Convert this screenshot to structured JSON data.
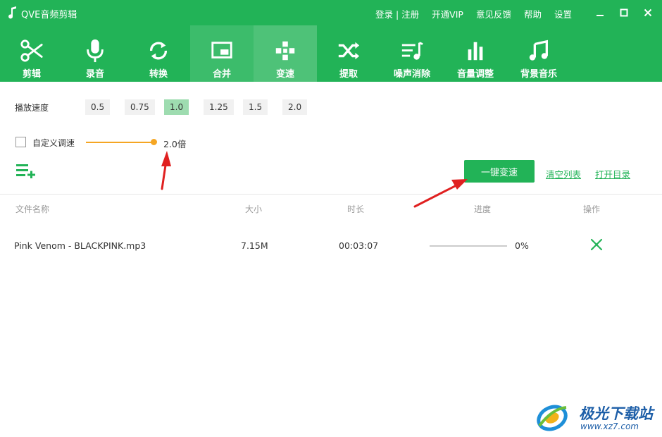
{
  "app": {
    "title": "QVE音频剪辑"
  },
  "top_links": {
    "login_register": "登录 | 注册",
    "vip": "开通VIP",
    "feedback": "意见反馈",
    "help": "帮助",
    "settings": "设置"
  },
  "tabs": [
    {
      "label": "剪辑",
      "icon": "scissors-icon"
    },
    {
      "label": "录音",
      "icon": "microphone-icon"
    },
    {
      "label": "转换",
      "icon": "convert-icon"
    },
    {
      "label": "合并",
      "icon": "merge-icon"
    },
    {
      "label": "变速",
      "icon": "speed-icon"
    },
    {
      "label": "提取",
      "icon": "shuffle-icon"
    },
    {
      "label": "噪声消除",
      "icon": "noise-icon"
    },
    {
      "label": "音量调整",
      "icon": "volume-bars-icon"
    },
    {
      "label": "背景音乐",
      "icon": "music-note-icon"
    }
  ],
  "active_tab": "变速",
  "speed": {
    "label": "播放速度",
    "options": [
      "0.5",
      "0.75",
      "1.0",
      "1.25",
      "1.5",
      "2.0"
    ],
    "selected": "1.0"
  },
  "custom_speed": {
    "label": "自定义调速",
    "checked": false,
    "value": "2.0倍",
    "slider_fraction": 1.0
  },
  "actions": {
    "one_click": "一键变速",
    "clear_list": "清空列表",
    "open_dir": "打开目录"
  },
  "table": {
    "headers": [
      "文件名称",
      "大小",
      "时长",
      "进度",
      "操作"
    ],
    "rows": [
      {
        "name": "Pink Venom - BLACKPINK.mp3",
        "size": "7.15M",
        "duration": "00:03:07",
        "progress": "0%",
        "progress_value": 0
      }
    ]
  },
  "watermark": {
    "name": "极光下载站",
    "url": "www.xz7.com"
  },
  "colors": {
    "brand": "#22b357",
    "slider": "#f5a623",
    "selected_speed": "#9edcb0",
    "annotation": "#e02020"
  }
}
